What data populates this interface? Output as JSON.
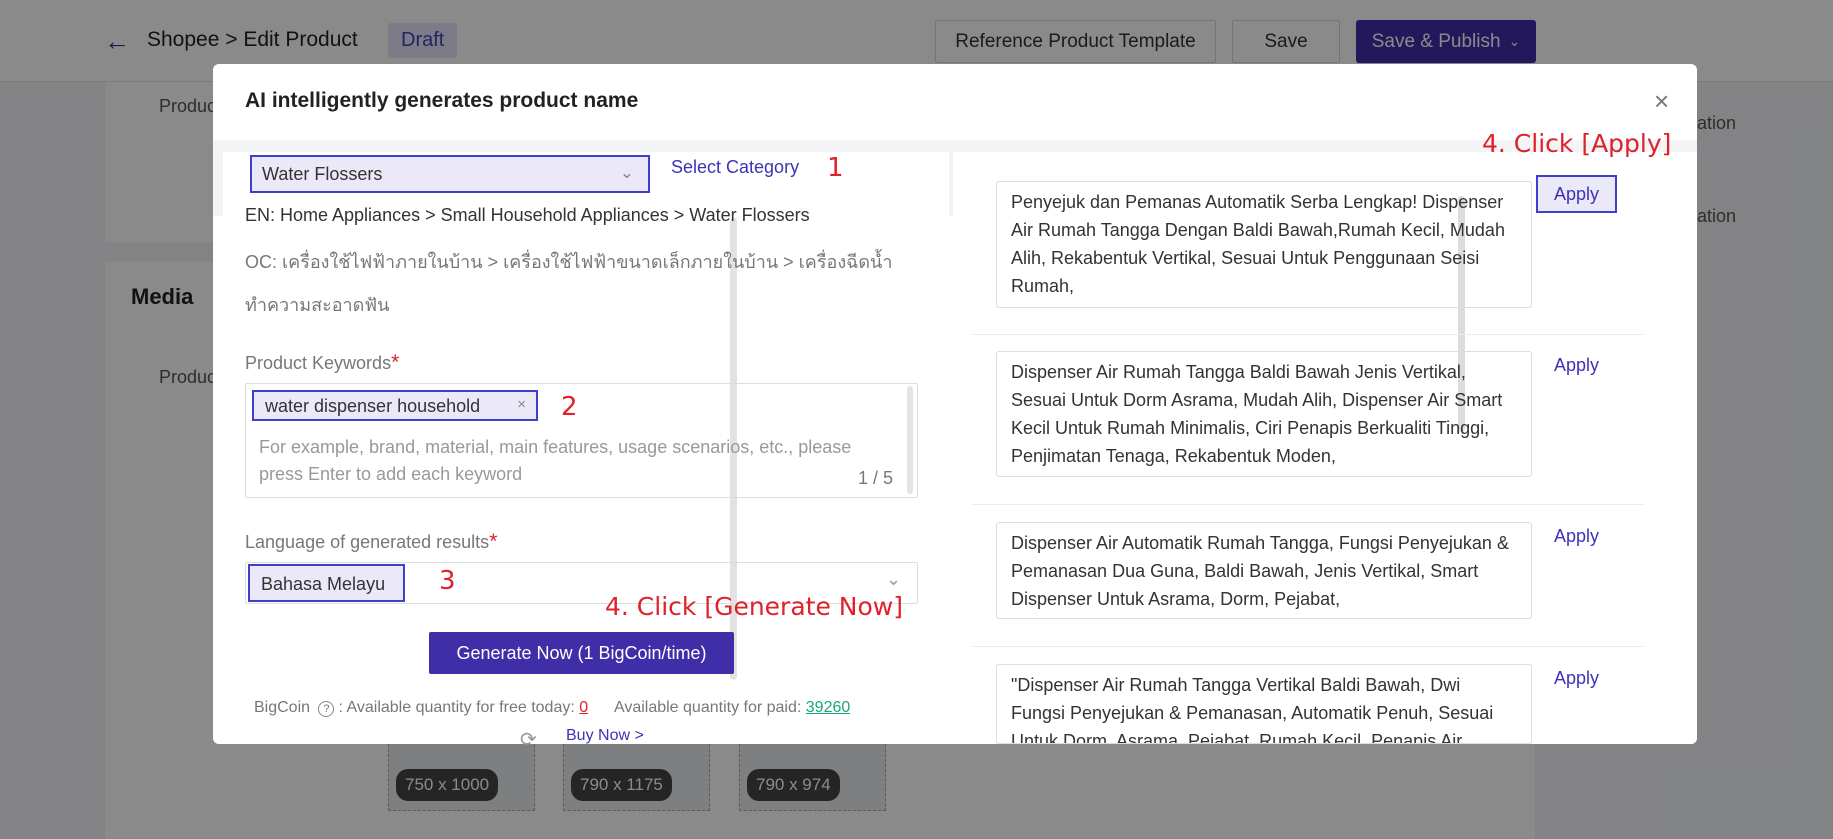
{
  "header": {
    "back_icon": "arrow-left-icon",
    "breadcrumb": "Shopee > Edit Product",
    "status_badge": "Draft",
    "reference_template_label": "Reference Product Template",
    "save_label": "Save",
    "publish_label": "Save & Publish",
    "publish_chevron": "chevron-down-icon"
  },
  "background": {
    "field_label_1": "Produc",
    "field_label_2": "Produc",
    "right_label_1": "ation",
    "right_label_2": "ation",
    "media_title": "Media",
    "thumbnails": [
      {
        "label": "750 x 1000"
      },
      {
        "label": "790 x 1175"
      },
      {
        "label": "790 x 974"
      }
    ]
  },
  "modal": {
    "title": "AI intelligently generates product name",
    "close_icon": "×",
    "category": {
      "selected": "Water Flossers",
      "select_link": "Select Category",
      "step_marker": "1",
      "en_path": "EN: Home Appliances > Small Household Appliances > Water Flossers",
      "oc_path": "OC: เครื่องใช้ไฟฟ้าภายในบ้าน > เครื่องใช้ไฟฟ้าขนาดเล็กภายในบ้าน > เครื่องฉีดน้ำทำความสะอาดฟัน"
    },
    "keywords": {
      "label": "Product Keywords",
      "required_mark": "*",
      "tag": "water dispenser household",
      "tag_remove": "×",
      "step_marker": "2",
      "placeholder": "For example, brand, material, main features, usage scenarios, etc., please press Enter to add each keyword",
      "count": "1 / 5"
    },
    "language": {
      "label": "Language of generated results",
      "required_mark": "*",
      "selected": "Bahasa Melayu",
      "step_marker": "3"
    },
    "generate_hint": "4. Click [Generate Now]",
    "generate_button": "Generate Now (1 BigCoin/time)",
    "bigcoin": {
      "label": "BigCoin",
      "help_icon": "?",
      "free_label": ": Available quantity for free today:",
      "free_value": "0",
      "paid_label": "Available quantity for paid:",
      "paid_value": "39260",
      "refresh_icon": "⟳",
      "buy_now": "Buy Now >"
    },
    "apply_hint": "4. Click [Apply]",
    "results": [
      {
        "text": "Penyejuk dan Pemanas Automatik Serba Lengkap! Dispenser Air Rumah Tangga Dengan Baldi Bawah,Rumah Kecil, Mudah Alih, Rekabentuk Vertikal, Sesuai Untuk Penggunaan Seisi Rumah,",
        "apply": "Apply"
      },
      {
        "text": "Dispenser Air Rumah Tangga Baldi Bawah Jenis Vertikal, Sesuai Untuk Dorm Asrama, Mudah Alih, Dispenser Air Smart Kecil Untuk Rumah Minimalis, Ciri Penapis Berkualiti Tinggi, Penjimatan Tenaga, Rekabentuk Moden,",
        "apply": "Apply"
      },
      {
        "text": "Dispenser Air Automatik Rumah Tangga, Fungsi Penyejukan & Pemanasan Dua Guna, Baldi Bawah, Jenis Vertikal, Smart Dispenser Untuk Asrama, Dorm, Pejabat,",
        "apply": "Apply"
      },
      {
        "text": "\"Dispenser Air Rumah Tangga Vertikal Baldi Bawah, Dwi Fungsi Penyejukan & Pemanasan, Automatik Penuh, Sesuai Untuk Dorm, Asrama, Pejabat, Rumah Kecil, Penapis Air",
        "apply": "Apply"
      }
    ]
  }
}
